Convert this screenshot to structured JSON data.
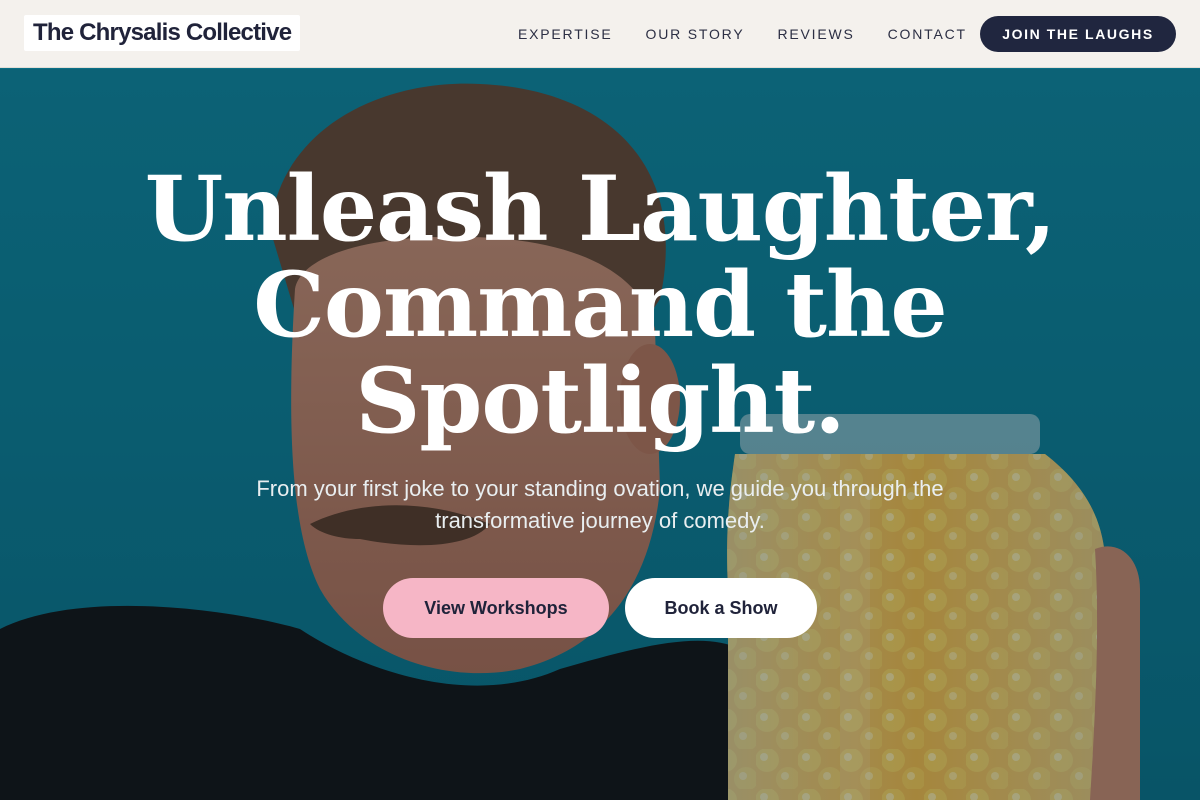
{
  "brand": {
    "name": "The Chrysalis Collective"
  },
  "nav": {
    "items": [
      {
        "label": "EXPERTISE"
      },
      {
        "label": "OUR STORY"
      },
      {
        "label": "REVIEWS"
      },
      {
        "label": "CONTACT"
      }
    ],
    "cta_label": "JOIN THE LAUGHS"
  },
  "hero": {
    "headline": [
      "Unleash Laughter,",
      "Command the",
      "Spotlight."
    ],
    "subtext": "From your first joke to your standing ovation, we guide you through the transformative journey of comedy.",
    "primary_button": "View Workshops",
    "secondary_button": "Book a Show"
  },
  "colors": {
    "header_bg": "#f4f1ed",
    "cta_bg": "#20263f",
    "hero_bg": "#0f7f96",
    "primary_button_bg": "#f6b6c6",
    "secondary_button_bg": "#ffffff",
    "jar_fill": "#f6b91a"
  }
}
